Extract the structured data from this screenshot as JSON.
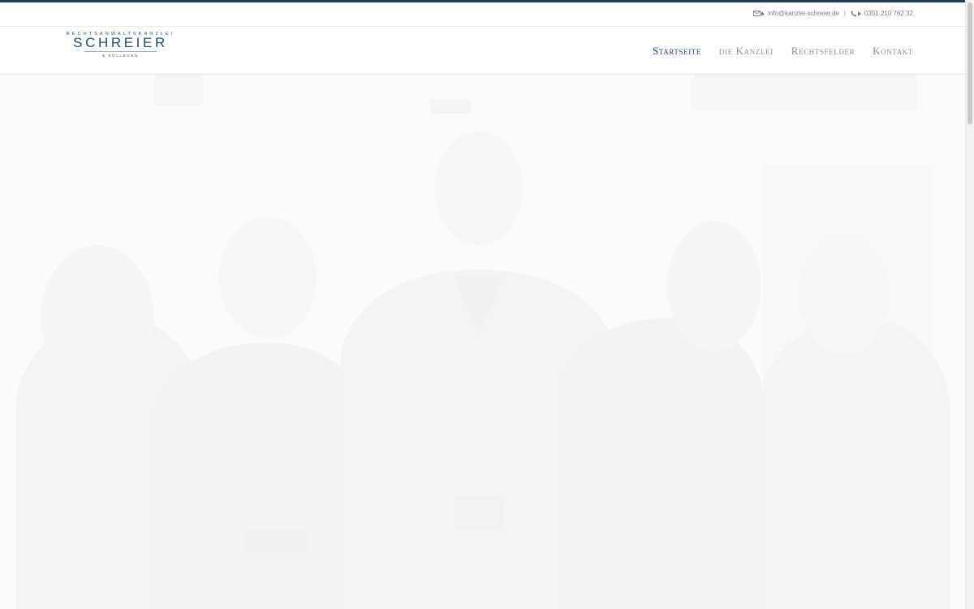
{
  "topbar": {
    "email": "info@kanzlei-schreier.de",
    "phone": "0351 210 762 32",
    "separator": "|",
    "email_icon": "envelope-icon",
    "phone_icon": "phone-icon"
  },
  "logo": {
    "line1": "RECHTSANWALTSKANZLEI",
    "name": "SCHREIER",
    "line3": "& KOLLEGEN"
  },
  "nav": {
    "items": [
      {
        "label": "Startseite",
        "active": true
      },
      {
        "label": "die Kanzlei",
        "active": false
      },
      {
        "label": "Rechtsfelder",
        "active": false
      },
      {
        "label": "Kontakt",
        "active": false
      }
    ]
  },
  "colors": {
    "accent": "#1d3e5c",
    "nav_active": "#1f4575",
    "nav_inactive": "#8d8d8d",
    "logo_blue": "#1c4c83"
  }
}
